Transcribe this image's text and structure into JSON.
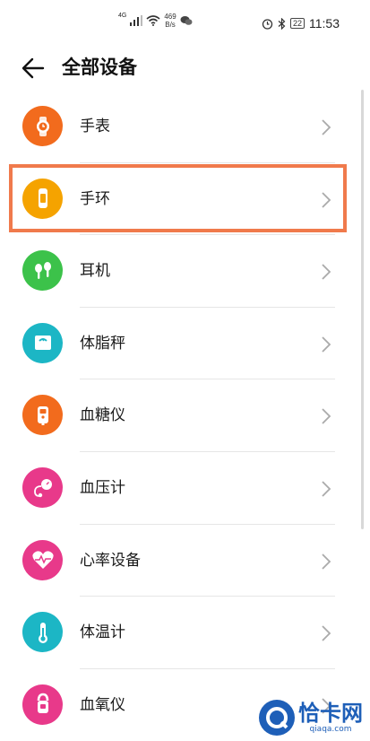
{
  "status_bar": {
    "signal_label": "4G",
    "net_speed_value": "469",
    "net_speed_unit": "B/s",
    "battery_level": "22",
    "time": "11:53"
  },
  "header": {
    "back_icon": "arrow-left-icon",
    "title": "全部设备"
  },
  "devices": [
    {
      "label": "手表",
      "icon": "watch-icon",
      "color": "#f26b1d"
    },
    {
      "label": "手环",
      "icon": "band-icon",
      "color": "#f5a300",
      "highlighted": true
    },
    {
      "label": "耳机",
      "icon": "earphone-icon",
      "color": "#3cc24a"
    },
    {
      "label": "体脂秤",
      "icon": "scale-icon",
      "color": "#1cb6c5"
    },
    {
      "label": "血糖仪",
      "icon": "glucose-meter-icon",
      "color": "#f26b1d"
    },
    {
      "label": "血压计",
      "icon": "blood-pressure-icon",
      "color": "#e8398a"
    },
    {
      "label": "心率设备",
      "icon": "heart-rate-icon",
      "color": "#e8398a"
    },
    {
      "label": "体温计",
      "icon": "thermometer-icon",
      "color": "#1cb6c5"
    },
    {
      "label": "血氧仪",
      "icon": "oximeter-icon",
      "color": "#e8398a"
    }
  ],
  "chevron_icon": "chevron-right-icon",
  "highlight_color": "#f07a4c",
  "watermark": {
    "title": "恰卡网",
    "url": "qiaqa.com",
    "color": "#1e5fb8"
  }
}
